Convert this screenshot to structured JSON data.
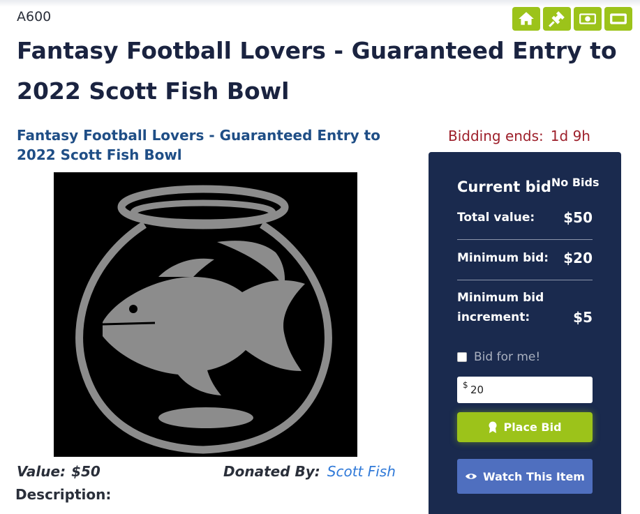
{
  "item": {
    "code": "A600",
    "title": "Fantasy Football Lovers - Guaranteed Entry to 2022 Scott Fish Bowl",
    "subtitle": "Fantasy Football Lovers - Guaranteed Entry to 2022 Scott Fish Bowl",
    "value_label": "Value:",
    "value_amount": "$50",
    "donated_label": "Donated By:",
    "donor": "Scott Fish",
    "description_label": "Description:"
  },
  "nav": {
    "icons": [
      "home-icon",
      "gavel-icon",
      "money-icon",
      "ticket-icon"
    ],
    "accent": "#9cc31a"
  },
  "bidding": {
    "ends_label": "Bidding ends:",
    "ends_time": "1d 9h",
    "current_bid_label": "Current bid",
    "current_bid_value": "No Bids",
    "total_value_label": "Total value:",
    "total_value": "$50",
    "min_bid_label": "Minimum bid:",
    "min_bid": "$20",
    "min_increment_label": "Minimum bid increment:",
    "min_increment": "$5",
    "bid_for_me_label": "Bid for me!",
    "currency_symbol": "$",
    "bid_amount": "20",
    "place_bid_label": "Place Bid",
    "watch_label": "Watch This Item"
  },
  "colors": {
    "panel_bg": "#1a2a4e",
    "green": "#9cc31a",
    "blue_button": "#4f6fbf",
    "ends_red": "#9d1f2a"
  }
}
